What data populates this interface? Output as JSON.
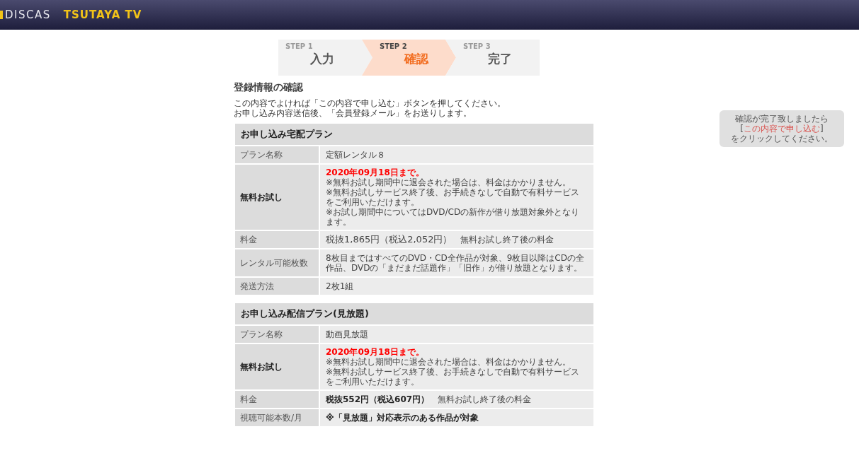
{
  "header": {
    "brand_primary": "DISCAS",
    "brand_secondary": "TSUTAYA TV"
  },
  "steps": [
    {
      "step": "STEP 1",
      "label": "入力",
      "selected": false
    },
    {
      "step": "STEP 2",
      "label": "確認",
      "selected": true
    },
    {
      "step": "STEP 3",
      "label": "完了",
      "selected": false
    }
  ],
  "title": "登録情報の確認",
  "intro": [
    "この内容でよければ「この内容で申し込む」ボタンを押してください。",
    "お申し込み内容送信後、「会員登録メール」をお送りします。"
  ],
  "plans": [
    {
      "title": "お申し込み宅配プラン",
      "rows": [
        {
          "label": "プラン名称",
          "kind": "text",
          "value": "定額レンタル８",
          "bold": false
        },
        {
          "label": "無料お試し",
          "kind": "trial",
          "deadline": "2020年09月18日まで。",
          "notes": [
            "※無料お試し期間中に退会された場合は、料金はかかりません。",
            "※無料お試しサービス終了後、お手続きなしで自動で有料サービスをご利用いただけます。",
            "※お試し期間中についてはDVD/CDの新作が借り放題対象外となります。"
          ]
        },
        {
          "label": "料金",
          "kind": "fee",
          "price": "税抜1,865円（税込2,052円）",
          "note": "無料お試し終了後の料金",
          "bold": false
        },
        {
          "label": "レンタル可能枚数",
          "kind": "text",
          "value": "8枚目まではすべてのDVD・CD全作品が対象、9枚目以降はCDの全作品、DVDの「まだまだ話題作」「旧作」が借り放題となります。",
          "bold": false
        },
        {
          "label": "発送方法",
          "kind": "text",
          "value": "2枚1組",
          "bold": false
        }
      ]
    },
    {
      "title": "お申し込み配信プラン(見放題)",
      "rows": [
        {
          "label": "プラン名称",
          "kind": "text",
          "value": "動画見放題",
          "bold": false
        },
        {
          "label": "無料お試し",
          "kind": "trial",
          "deadline": "2020年09月18日まで。",
          "notes": [
            "※無料お試し期間中に退会された場合は、料金はかかりません。",
            "※無料お試しサービス終了後、お手続きなしで自動で有料サービスをご利用いただけます。"
          ]
        },
        {
          "label": "料金",
          "kind": "fee",
          "price": "税抜552円（税込607円）",
          "note": "無料お試し終了後の料金",
          "bold": true
        },
        {
          "label": "視聴可能本数/月",
          "kind": "text",
          "value": "※「見放題」対応表示のある作品が対象",
          "bold": true
        }
      ]
    }
  ],
  "hint": {
    "text": "確認が完了致しましたら",
    "open": "[",
    "link": "この内容で申し込む",
    "close": "]",
    "after": "をクリックしてください。"
  }
}
